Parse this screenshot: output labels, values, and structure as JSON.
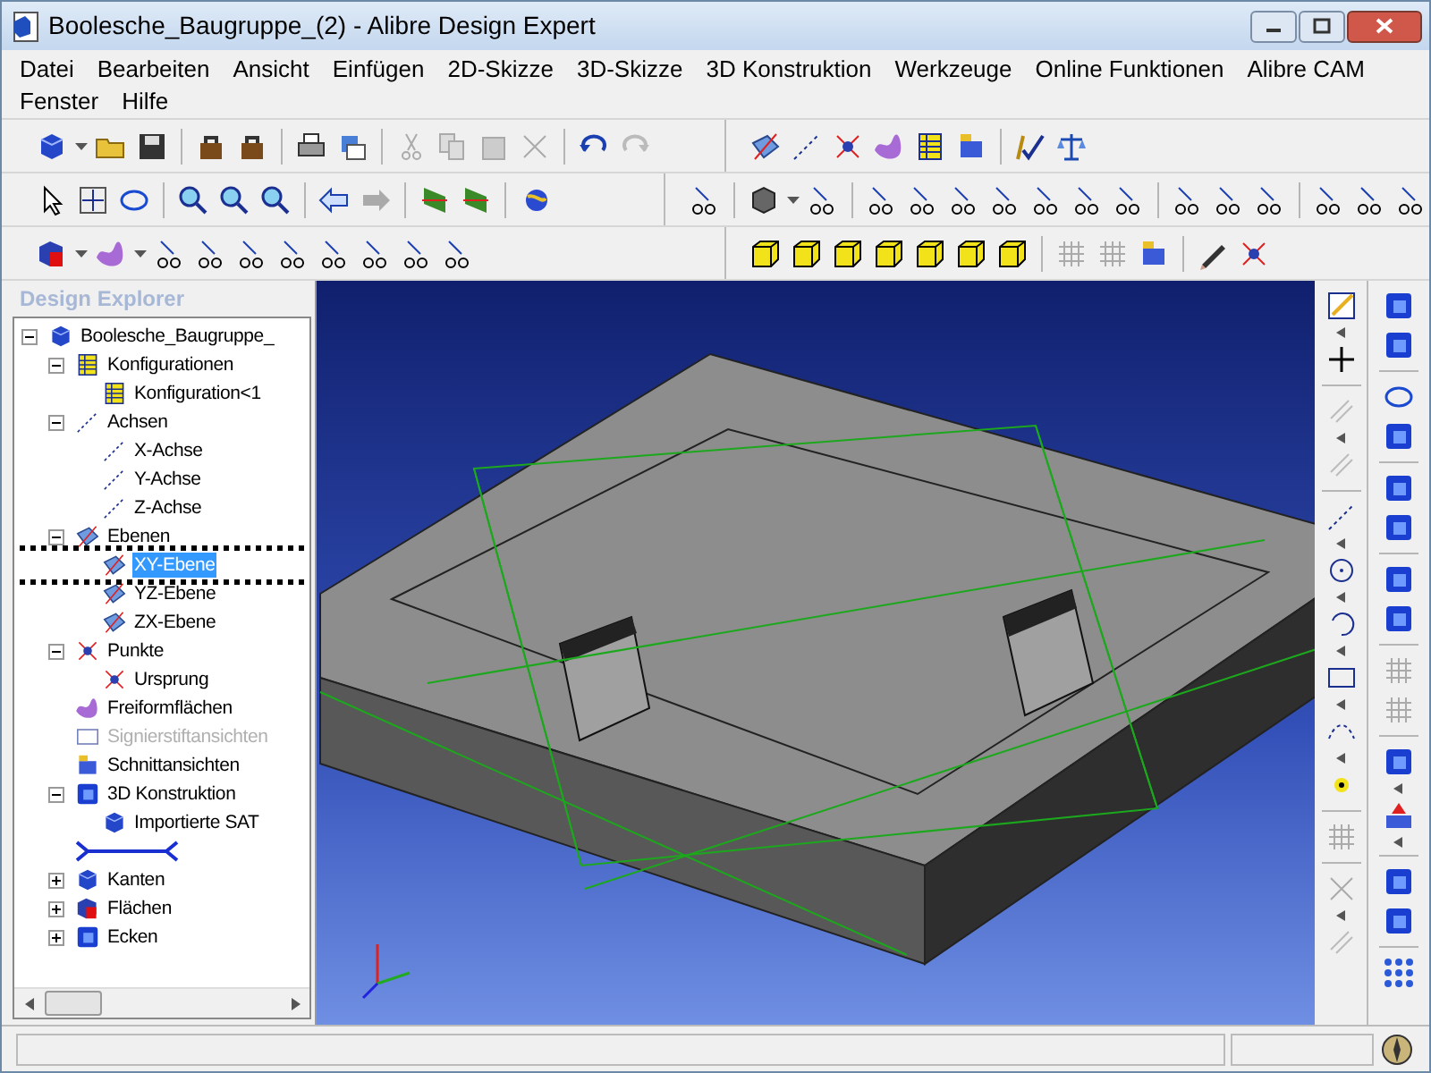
{
  "window": {
    "title": "Boolesche_Baugruppe_(2) - Alibre Design Expert"
  },
  "menu": [
    "Datei",
    "Bearbeiten",
    "Ansicht",
    "Einfügen",
    "2D-Skizze",
    "3D-Skizze",
    "3D Konstruktion",
    "Werkzeuge",
    "Online Funktionen",
    "Alibre CAM",
    "Fenster",
    "Hilfe"
  ],
  "explorer": {
    "title": "Design Explorer",
    "tree": [
      {
        "kind": "assembly",
        "label": "Boolesche_Baugruppe_",
        "expanded": true,
        "selected": false,
        "disabled": false,
        "children": [
          {
            "kind": "configurations",
            "label": "Konfigurationen",
            "expanded": true,
            "selected": false,
            "disabled": false,
            "children": [
              {
                "kind": "configuration",
                "label": "Konfiguration<1",
                "selected": false,
                "disabled": false
              }
            ]
          },
          {
            "kind": "axes",
            "label": "Achsen",
            "expanded": true,
            "selected": false,
            "disabled": false,
            "children": [
              {
                "kind": "axis",
                "label": "X-Achse",
                "selected": false,
                "disabled": false
              },
              {
                "kind": "axis",
                "label": "Y-Achse",
                "selected": false,
                "disabled": false
              },
              {
                "kind": "axis",
                "label": "Z-Achse",
                "selected": false,
                "disabled": false
              }
            ]
          },
          {
            "kind": "plane",
            "label": "Ebenen",
            "expanded": true,
            "selected": false,
            "disabled": false,
            "children": [
              {
                "kind": "plane",
                "label": "XY-Ebene",
                "selected": true,
                "disabled": false
              },
              {
                "kind": "plane",
                "label": "YZ-Ebene",
                "selected": false,
                "disabled": false
              },
              {
                "kind": "plane",
                "label": "ZX-Ebene",
                "selected": false,
                "disabled": false
              }
            ]
          },
          {
            "kind": "point",
            "label": "Punkte",
            "expanded": true,
            "selected": false,
            "disabled": false,
            "children": [
              {
                "kind": "point",
                "label": "Ursprung",
                "selected": false,
                "disabled": false
              }
            ]
          },
          {
            "kind": "freeform",
            "label": "Freiformflächen",
            "selected": false,
            "disabled": false
          },
          {
            "kind": "markup",
            "label": "Signierstiftansichten",
            "selected": false,
            "disabled": true
          },
          {
            "kind": "section",
            "label": "Schnittansichten",
            "selected": false,
            "disabled": false
          },
          {
            "kind": "construction",
            "label": "3D Konstruktion",
            "expanded": true,
            "selected": false,
            "disabled": false,
            "children": [
              {
                "kind": "sat",
                "label": "Importierte SAT",
                "selected": false,
                "disabled": false
              }
            ]
          },
          {
            "kind": "sketch",
            "selected": false,
            "disabled": false
          },
          {
            "kind": "edges",
            "label": "Kanten",
            "expanded": false,
            "selected": false,
            "disabled": false
          },
          {
            "kind": "faces",
            "label": "Flächen",
            "expanded": false,
            "selected": false,
            "disabled": false
          },
          {
            "kind": "vertices",
            "label": "Ecken",
            "expanded": false,
            "selected": false,
            "disabled": false
          }
        ]
      }
    ]
  }
}
